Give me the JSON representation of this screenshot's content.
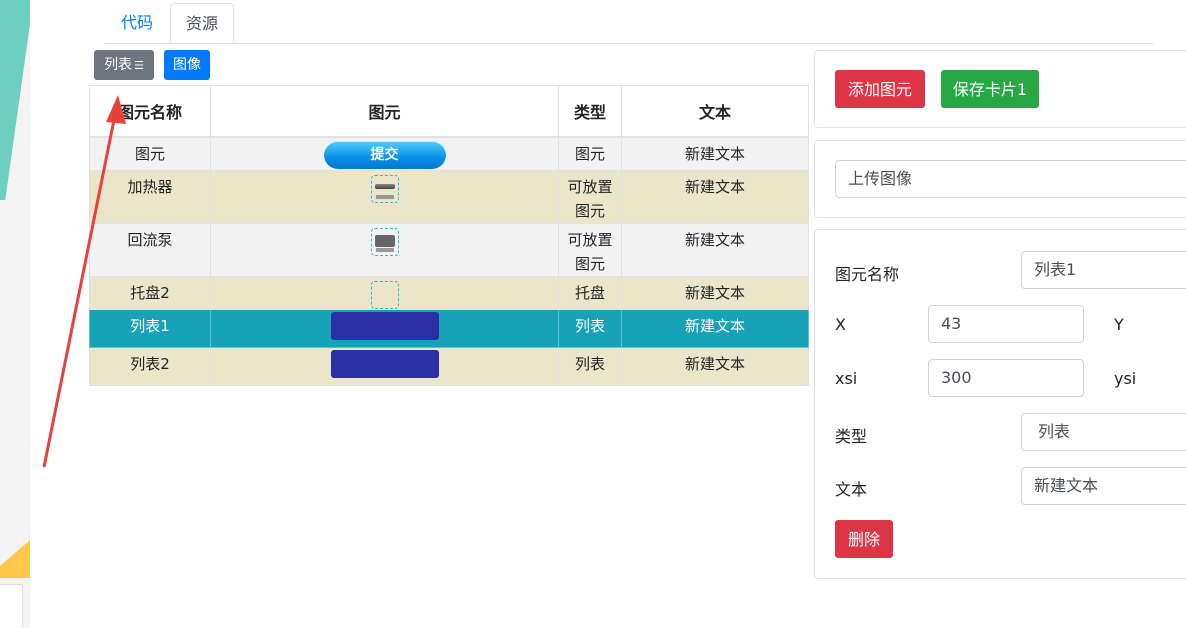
{
  "tabs": {
    "code": "代码",
    "resources": "资源"
  },
  "toolbar": {
    "list_button": "列表",
    "image_button": "图像"
  },
  "table": {
    "headers": [
      "图元名称",
      "图元",
      "类型",
      "文本"
    ],
    "rows": [
      {
        "name": "图元",
        "element": "提交",
        "type": "图元",
        "text": "新建文本"
      },
      {
        "name": "加热器",
        "element": "",
        "type": "可放置图元",
        "text": "新建文本"
      },
      {
        "name": "回流泵",
        "element": "",
        "type": "可放置图元",
        "text": "新建文本"
      },
      {
        "name": "托盘2",
        "element": "",
        "type": "托盘",
        "text": "新建文本"
      },
      {
        "name": "列表1",
        "element": "",
        "type": "列表",
        "text": "新建文本"
      },
      {
        "name": "列表2",
        "element": "",
        "type": "列表",
        "text": "新建文本"
      }
    ]
  },
  "actions": {
    "add_element": "添加图元",
    "save_card": "保存卡片1"
  },
  "upload": {
    "label": "上传图像"
  },
  "form": {
    "name_label": "图元名称",
    "name_value": "列表1",
    "x_label": "X",
    "x_value": "43",
    "y_label": "Y",
    "xsi_label": "xsi",
    "xsi_value": "300",
    "ysi_label": "ysi",
    "type_label": "类型",
    "type_value": "列表",
    "text_label": "文本",
    "text_value": "新建文本",
    "delete_button": "删除"
  },
  "colors": {
    "selected_row": "#17a2b8",
    "primary": "#007bff",
    "danger": "#dc3545",
    "success": "#28a745"
  }
}
